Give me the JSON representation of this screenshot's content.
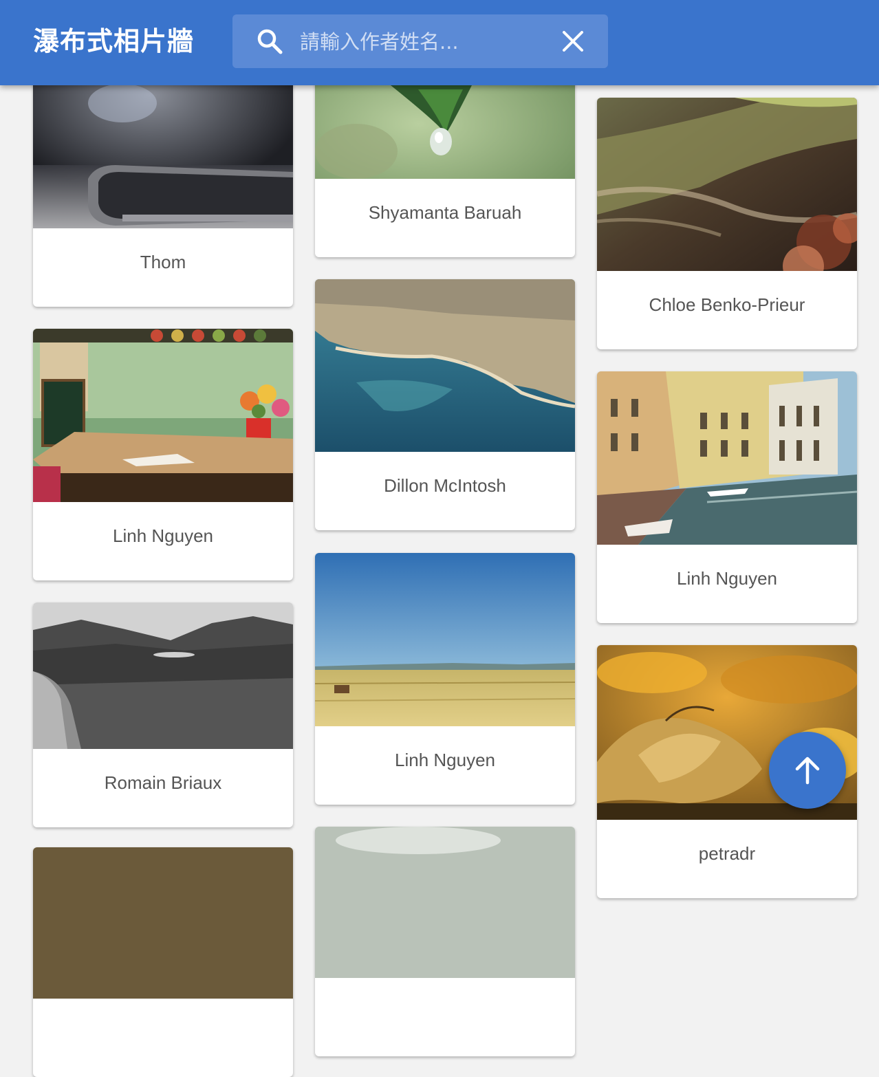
{
  "header": {
    "title": "瀑布式相片牆",
    "search": {
      "placeholder": "請輸入作者姓名...",
      "value": ""
    }
  },
  "photos": [
    {
      "author": "Thom",
      "subject": "smartphone"
    },
    {
      "author": "Linh Nguyen",
      "subject": "cafe table"
    },
    {
      "author": "Romain Briaux",
      "subject": "mountain valley"
    },
    {
      "author": "",
      "subject": "partial"
    },
    {
      "author": "Shyamanta Baruah",
      "subject": "water drop leaf"
    },
    {
      "author": "Dillon McIntosh",
      "subject": "aerial coastline"
    },
    {
      "author": "Linh Nguyen",
      "subject": "wheat field"
    },
    {
      "author": "",
      "subject": "partial"
    },
    {
      "author": "Chloe Benko-Prieur",
      "subject": "tree bark"
    },
    {
      "author": "Linh Nguyen",
      "subject": "canal town"
    },
    {
      "author": "petradr",
      "subject": "autumn leaves"
    }
  ],
  "colors": {
    "primary": "#3a74cc",
    "background": "#f2f2f2"
  },
  "icons": {
    "search": "search-icon",
    "clear": "close-icon",
    "fab": "arrow-up-icon"
  }
}
